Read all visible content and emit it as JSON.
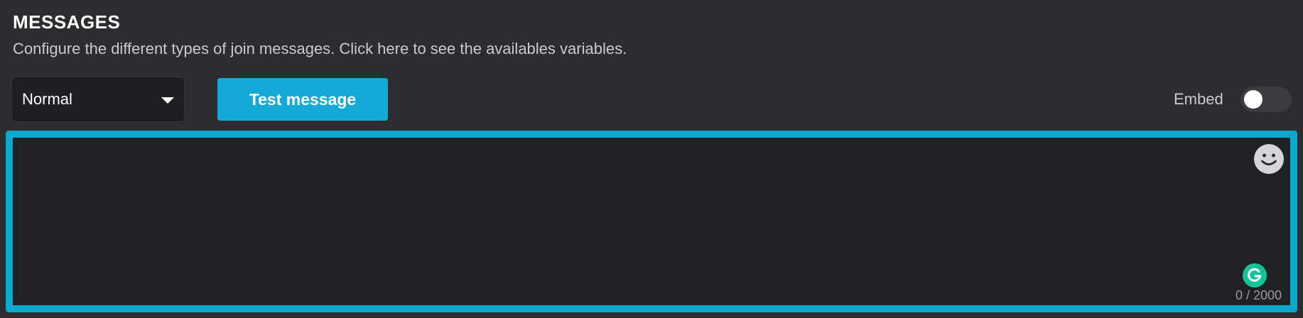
{
  "section": {
    "title": "MESSAGES",
    "description": "Configure the different types of join messages. Click here to see the availables variables."
  },
  "message_type_select": {
    "value": "Normal"
  },
  "test_button": {
    "label": "Test message"
  },
  "embed_toggle": {
    "label": "Embed",
    "on": false
  },
  "editor": {
    "value": "",
    "char_count": "0 / 2000"
  },
  "colors": {
    "accent": "#0aa8cf",
    "button": "#14a9d6",
    "background": "#2b2d31",
    "editor_bg": "#202124",
    "grammarly": "#15c39a"
  },
  "icons": {
    "emoji": "smiley-face-icon",
    "grammarly": "grammarly-icon",
    "select_caret": "chevron-down-icon"
  }
}
